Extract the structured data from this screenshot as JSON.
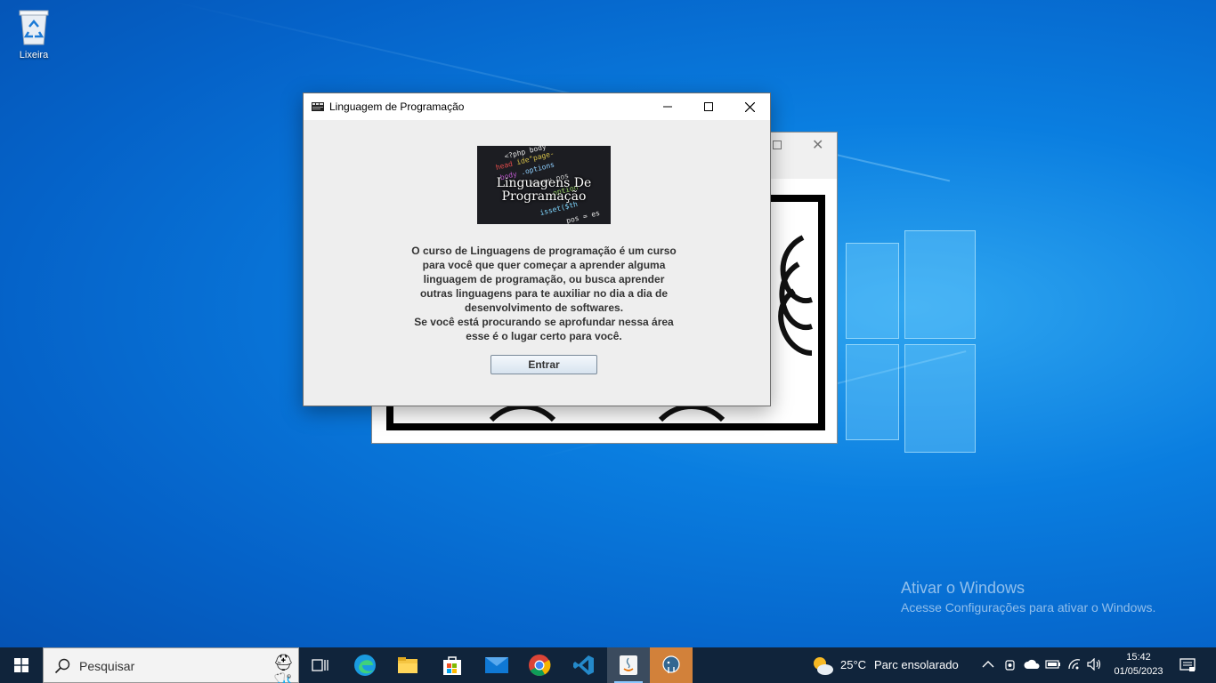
{
  "desktop": {
    "recycle_bin_label": "Lixeira",
    "activation_title": "Ativar o Windows",
    "activation_subtitle": "Acesse Configurações para ativar o Windows."
  },
  "dialog": {
    "title": "Linguagem de Programação",
    "banner_text": "Linguagens De\nProgramação",
    "description": "O curso de Linguagens de programação é um curso\npara você que quer começar a aprender alguma\nlinguagem de programação, ou busca aprender\noutras linguagens para te auxiliar no dia a dia de\ndesenvolvimento de softwares.\nSe você está procurando se aprofundar nessa área\nesse é o lugar certo para você.",
    "enter_button": "Entrar"
  },
  "taskbar": {
    "search_placeholder": "Pesquisar",
    "apps": [
      "task-view",
      "edge",
      "file-explorer",
      "microsoft-store",
      "mail",
      "chrome",
      "vscode",
      "java",
      "postgresql"
    ],
    "weather_temp": "25°C",
    "weather_desc": "Parc ensolarado",
    "time": "15:42",
    "date": "01/05/2023"
  },
  "colors": {
    "taskbar_bg": "#10243b",
    "dialog_bg": "#eeeeee",
    "wallpaper": "#0a7ee0"
  }
}
